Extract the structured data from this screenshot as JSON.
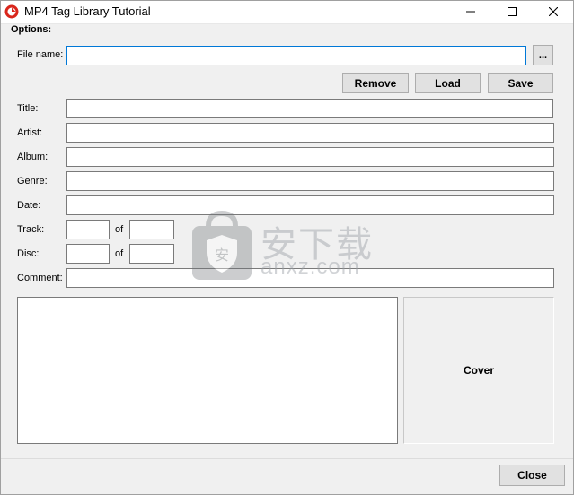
{
  "window": {
    "title": "MP4 Tag Library Tutorial"
  },
  "options": {
    "group_label": "Options:",
    "file_name_label": "File name:",
    "file_name_value": "",
    "browse_label": "...",
    "remove_label": "Remove",
    "load_label": "Load",
    "save_label": "Save"
  },
  "fields": {
    "title_label": "Title:",
    "artist_label": "Artist:",
    "album_label": "Album:",
    "genre_label": "Genre:",
    "date_label": "Date:",
    "track_label": "Track:",
    "track_of_label": "of",
    "disc_label": "Disc:",
    "disc_of_label": "of",
    "comment_label": "Comment:"
  },
  "cover": {
    "label": "Cover"
  },
  "footer": {
    "close_label": "Close"
  },
  "watermark": {
    "cn": "安下载",
    "en": "anxz.com"
  },
  "icons": {
    "app": "app-logo-icon",
    "minimize": "minimize-icon",
    "maximize": "maximize-icon",
    "close": "close-icon"
  },
  "colors": {
    "focus_border": "#0078d7",
    "window_bg": "#f0f0f0"
  }
}
